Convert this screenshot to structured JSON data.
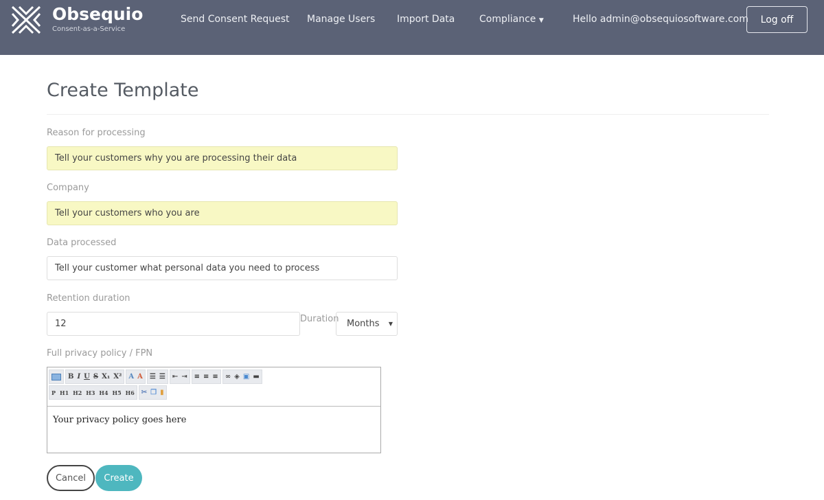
{
  "header": {
    "brand": "Obsequio",
    "tagline": "Consent-as-a-Service",
    "nav": [
      "Send Consent Request",
      "Manage Users",
      "Import Data",
      "Compliance"
    ],
    "greeting": "Hello admin@obsequiosoftware.com",
    "logoff": "Log off"
  },
  "page": {
    "title": "Create Template"
  },
  "form": {
    "reason_label": "Reason for processing",
    "reason_value": "Tell your customers why you are processing their data",
    "company_label": "Company",
    "company_value": "Tell your customers who you are",
    "data_label": "Data processed",
    "data_value": "Tell your customer what personal data you need to process",
    "retention_label": "Retention duration",
    "retention_value": "12",
    "duration_label": "Duration",
    "duration_value": "Months",
    "policy_label": "Full privacy policy / FPN",
    "policy_value": "Your privacy policy goes here",
    "toolbar_headings": [
      "P",
      "H1",
      "H2",
      "H3",
      "H4",
      "H5",
      "H6"
    ],
    "cancel": "Cancel",
    "create": "Create"
  }
}
